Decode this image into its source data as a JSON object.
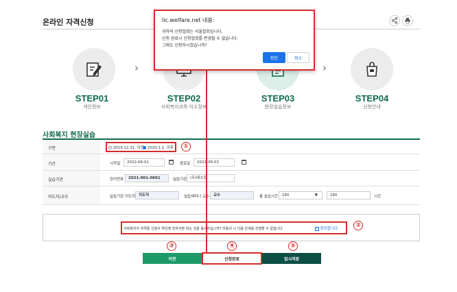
{
  "page": {
    "title": "온라인 자격신청"
  },
  "steps": [
    {
      "num": "01",
      "prefix": "STEP",
      "label": "개인정보",
      "icon": "pencil-document-icon"
    },
    {
      "num": "02",
      "prefix": "STEP",
      "label": "사회복지과목 이수정보",
      "icon": "monitor-icon"
    },
    {
      "num": "03",
      "prefix": "STEP",
      "label": "현장실습정보",
      "icon": "clipboard-icon"
    },
    {
      "num": "04",
      "prefix": "STEP",
      "label": "신청안내",
      "icon": "shopping-bag-icon"
    }
  ],
  "section": {
    "title": "사회복지 현장실습"
  },
  "form": {
    "type_label": "구분",
    "type_option1": "2019.12.31. 이전",
    "type_option2": "2020.1.1. 이후",
    "period_label": "기간",
    "start_label": "시작일",
    "start_value": "2022-06-01",
    "end_label": "종료일",
    "end_value": "2022-06-03",
    "institution_label": "실습기관",
    "mgmt_no_label": "관리번호",
    "mgmt_no_value": "2021-001-0001",
    "inst_name_label": "실습기관",
    "inst_name_value": "(주)테스트",
    "supervisor_label": "지도자/교수",
    "inst_supervisor_label": "실습기관 지도자",
    "inst_supervisor_value": "지도자",
    "seminar_prof_label": "실습세미나 교수",
    "seminar_prof_value": "교수",
    "total_hours_label": "총 실습시간",
    "total_hours_value": "160",
    "hours_value": "160",
    "hours_unit": "시간"
  },
  "agreement": {
    "text": "사회복지사 자격증 신청서 하단에 전자서명 되는 것을 동의하십니까? 미동의 시 다음 단계를 진행할 수 없습니다.",
    "checkbox_label": "동의합니다."
  },
  "buttons": {
    "prev": "이전",
    "submit": "신청완료",
    "save": "임시저장"
  },
  "annotations": {
    "n1": "①",
    "n2": "②",
    "n3": "③",
    "n4": "④",
    "n5": "⑤"
  },
  "dialog": {
    "title": "lic.welfare.net 내용:",
    "line1": "귀하의 신청협회는 서울협회입니다.",
    "line2": "신청 완료시 신청협회를 변경할 수 없습니다.",
    "line3": "그래도 신청하시겠습니까?",
    "ok": "확인",
    "cancel": "취소"
  },
  "colors": {
    "accent": "#0e6a4b",
    "annotation": "#d62a2a",
    "dialog_button": "#1a73e8"
  }
}
